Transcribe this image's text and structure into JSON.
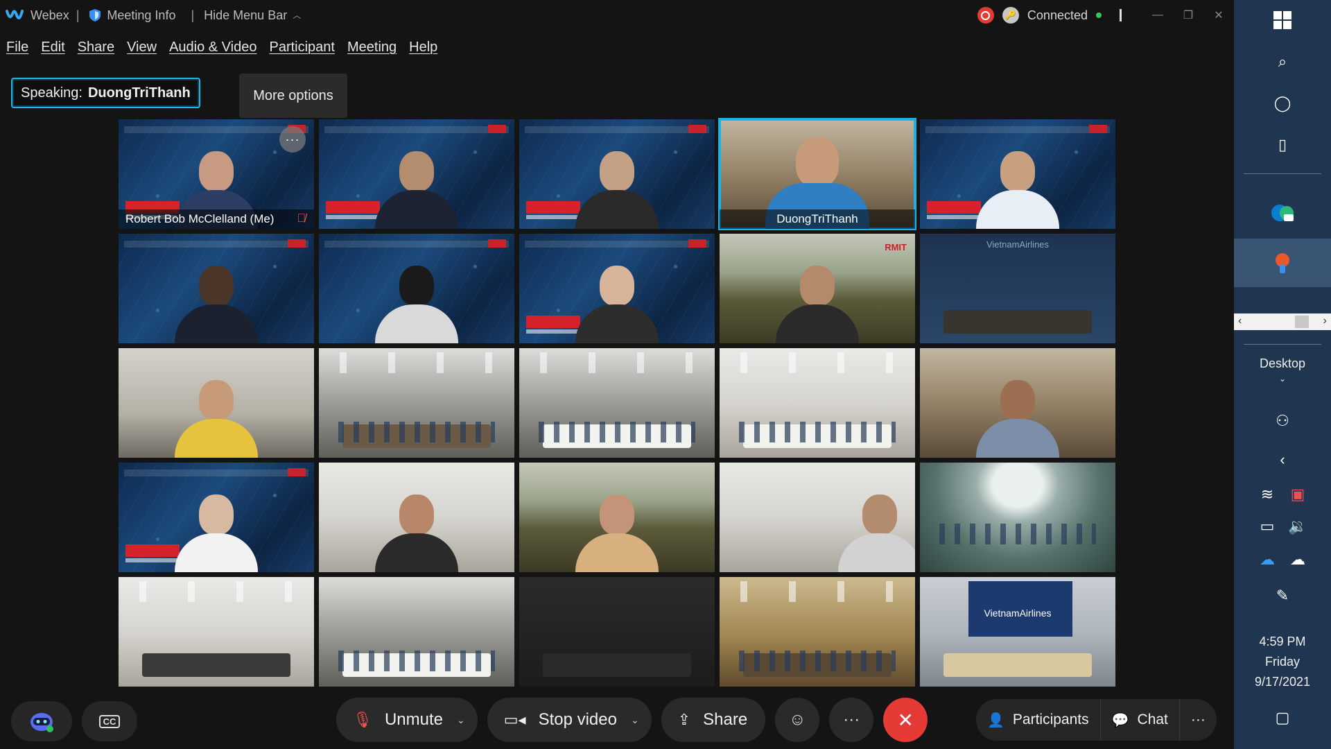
{
  "titlebar": {
    "app_name": "Webex",
    "meeting_info": "Meeting Info",
    "hide_menu_bar": "Hide Menu Bar",
    "status": "Connected",
    "accent": "#22b6e8"
  },
  "menu": [
    "File",
    "Edit",
    "Share",
    "View",
    "Audio & Video",
    "Participant",
    "Meeting",
    "Help"
  ],
  "speaking": {
    "label": "Speaking:",
    "name": "DuongTriThanh"
  },
  "tooltip": "More options",
  "tiles": [
    {
      "name": "Robert Bob McClelland  (Me)",
      "muted": true,
      "more_button": "···"
    },
    {
      "name": "DuongTriThanh"
    }
  ],
  "slide_logo": {
    "rmit": "RMIT",
    "vietnam_airlines": "VietnamAirlines"
  },
  "toolbar": {
    "unmute": "Unmute",
    "stop_video": "Stop video",
    "share": "Share",
    "more": "···",
    "participants": "Participants",
    "chat": "Chat",
    "more_right": "···",
    "cc": "CC",
    "leave_color": "#e63a36"
  },
  "taskbar": {
    "desktop": "Desktop",
    "time": "4:59 PM",
    "day": "Friday",
    "date": "9/17/2021"
  }
}
